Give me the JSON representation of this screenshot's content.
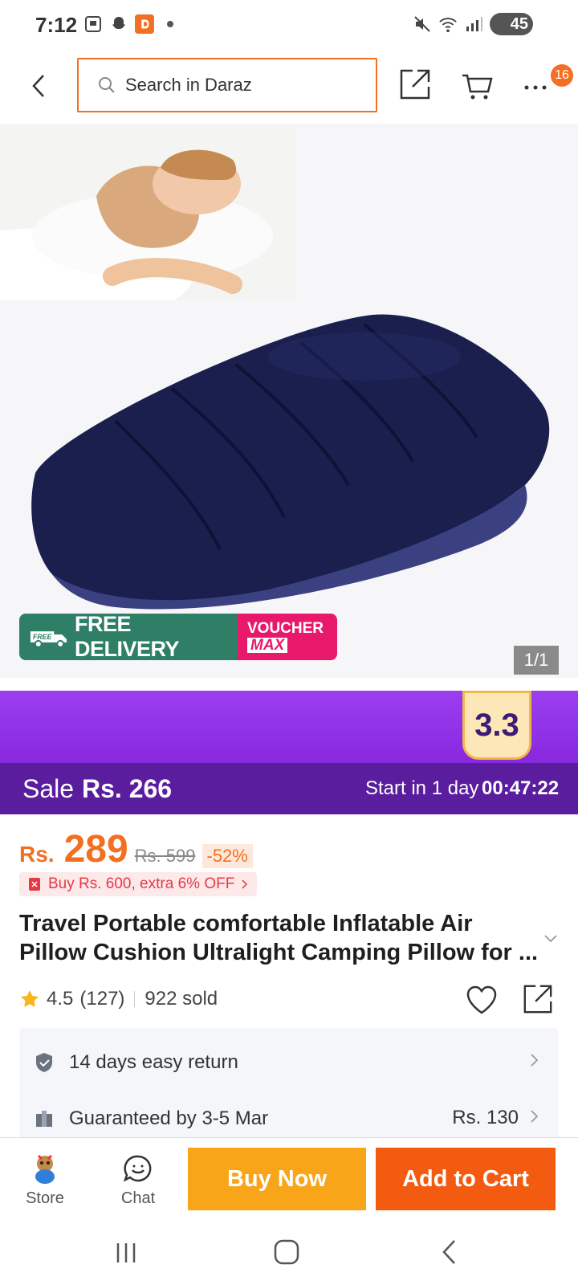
{
  "status_bar": {
    "time": "7:12",
    "battery": "45"
  },
  "search": {
    "placeholder": "Search in Daraz"
  },
  "header": {
    "cart_badge": "16"
  },
  "gallery": {
    "free_delivery_tag": "FREE",
    "free_delivery_label": "FREE DELIVERY",
    "voucher_label": "VOUCHER",
    "voucher_max": "MAX",
    "counter": "1/1"
  },
  "promo": {
    "campaign_logo": "3.3",
    "sale_label": "Sale",
    "sale_price": "Rs. 266",
    "start_label": "Start in 1 day",
    "countdown": "00:47:22"
  },
  "price": {
    "currency": "Rs.",
    "current": "289",
    "original": "Rs. 599",
    "discount": "-52%"
  },
  "bundle_offer": "Buy Rs. 600, extra 6% OFF",
  "product": {
    "title": "Travel Portable comfortable Inflatable Air Pillow Cushion Ultralight Camping Pillow for ...",
    "rating": "4.5",
    "reviews": "(127)",
    "sold": "922 sold"
  },
  "services": [
    {
      "label": "14 days easy return"
    },
    {
      "label": "Guaranteed by 3-5 Mar",
      "fee": "Rs. 130"
    }
  ],
  "bottom": {
    "store_label": "Store",
    "chat_label": "Chat",
    "buy_now": "Buy Now",
    "add_to_cart": "Add to Cart"
  },
  "colors": {
    "accent": "#f36f21",
    "buy_now": "#f9a51a",
    "add_to_cart": "#f35b11",
    "promo_purple": "#8a2be2",
    "free_delivery_green": "#2e7f66",
    "voucher_pink": "#e8186b"
  }
}
